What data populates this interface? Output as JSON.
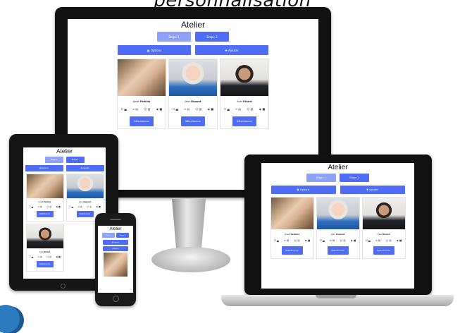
{
  "caption": "personnalisation",
  "app": {
    "title": "Atelier",
    "tabs": [
      "Etape 1",
      "Etape 2"
    ],
    "actions": {
      "left_icon": "▦",
      "left_label": "Options",
      "right_icon": "✚",
      "right_label": "Ajouter"
    },
    "select_label": "Sélectionner",
    "icons": {
      "stats": "☷ ▄",
      "doc": "≡ ▤",
      "people": "☺ ▥",
      "camera": "◉ ■"
    },
    "people": [
      {
        "first": "Janet",
        "last": "Perkins",
        "photo_class": "p1"
      },
      {
        "first": "Jean",
        "last": "Dupont",
        "photo_class": "p2"
      },
      {
        "first": "Axel",
        "last": "Ricard",
        "photo_class": "p3"
      }
    ]
  }
}
